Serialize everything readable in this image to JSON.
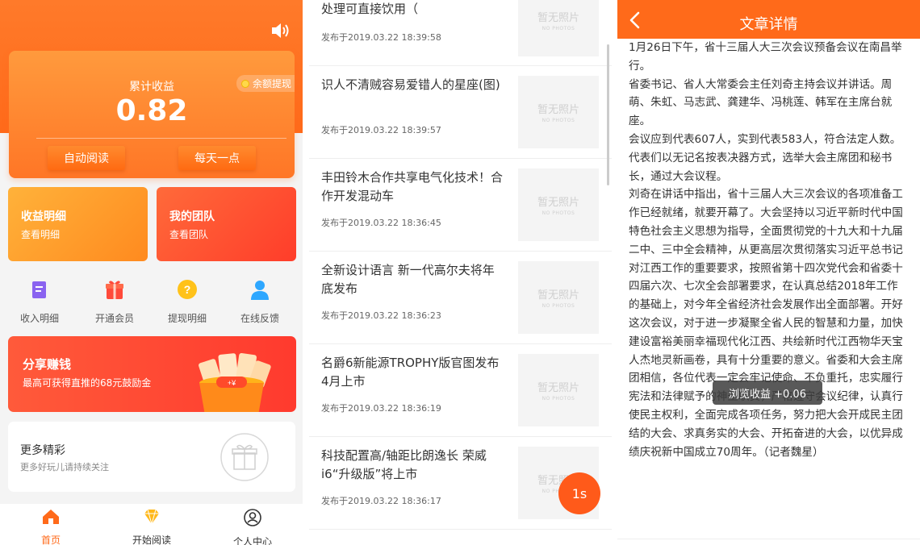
{
  "home": {
    "earnings": {
      "label": "累计收益",
      "value": "0.82",
      "withdraw_chip": "余额提现",
      "btn_auto_read": "自动阅读",
      "btn_daily": "每天一点"
    },
    "tiles": [
      {
        "title": "收益明细",
        "sub": "查看明细"
      },
      {
        "title": "我的团队",
        "sub": "查看团队"
      }
    ],
    "quick": [
      {
        "label": "收入明细",
        "icon": "document-icon"
      },
      {
        "label": "开通会员",
        "icon": "gift-box-icon"
      },
      {
        "label": "提现明细",
        "icon": "question-icon"
      },
      {
        "label": "在线反馈",
        "icon": "person-icon"
      }
    ],
    "share": {
      "title": "分享赚钱",
      "sub": "最高可获得直推的68元鼓励金"
    },
    "more": {
      "title": "更多精彩",
      "sub": "更多好玩儿请持续关注"
    },
    "tabs": [
      {
        "label": "首页",
        "icon": "home-icon"
      },
      {
        "label": "开始阅读",
        "icon": "diamond-icon"
      },
      {
        "label": "个人中心",
        "icon": "user-circle-icon"
      }
    ]
  },
  "news_list": {
    "placeholder_cn": "暂无照片",
    "placeholder_en": "NO PHOTOS",
    "items": [
      {
        "title": "处理可直接饮用（",
        "time": "发布于2019.03.22 18:39:58"
      },
      {
        "title": "识人不清贼容易爱错人的星座(图)",
        "time": "发布于2019.03.22 18:39:57"
      },
      {
        "title": "丰田铃木合作共享电气化技术！合作开发混动车",
        "time": "发布于2019.03.22 18:36:45"
      },
      {
        "title": "全新设计语言 新一代高尔夫将年底发布",
        "time": "发布于2019.03.22 18:36:23"
      },
      {
        "title": "名爵6新能源TROPHY版官图发布 4月上市",
        "time": "发布于2019.03.22 18:36:19"
      },
      {
        "title": "科技配置高/轴距比朗逸长 荣威i6“升级版”将上市",
        "time": "发布于2019.03.22 18:36:17"
      }
    ],
    "timer": "1s"
  },
  "article": {
    "header_title": "文章详情",
    "paragraphs": [
      "1月26日下午，省十三届人大三次会议预备会议在南昌举行。",
      "省委书记、省人大常委会主任刘奇主持会议并讲话。周萌、朱虹、马志武、龚建华、冯桃莲、韩军在主席台就座。",
      "会议应到代表607人，实到代表583人，符合法定人数。代表们以无记名按表决器方式，选举大会主席团和秘书长，通过大会议程。",
      "刘奇在讲话中指出，省十三届人大三次会议的各项准备工作已经就绪，就要开幕了。大会坚持以习近平新时代中国特色社会主义思想为指导，全面贯彻党的十九大和十九届二中、三中全会精神，从更高层次贯彻落实习近平总书记对江西工作的重要要求，按照省第十四次党代会和省委十四届六次、七次全会部署要求，在认真总结2018年工作的基础上，对今年全省经济社会发展作出全面部署。开好这次会议，对于进一步凝聚全省人民的智慧和力量，加快建设富裕美丽幸福现代化江西、共绘新时代江西物华天宝人杰地灵新画卷，具有十分重要的意义。省委和大会主席团相信，各位代表一定会牢记使命、不负重托，忠实履行宪法和法律赋予的神圣职责，严格遵守会议纪律，认真行使民主权利，全面完成各项任务，努力把大会开成民主团结的大会、求真务实的大会、开拓奋进的大会，以优异成绩庆祝新中国成立70周年。（记者魏星）"
    ],
    "toast": "浏览收益 +0.06"
  }
}
